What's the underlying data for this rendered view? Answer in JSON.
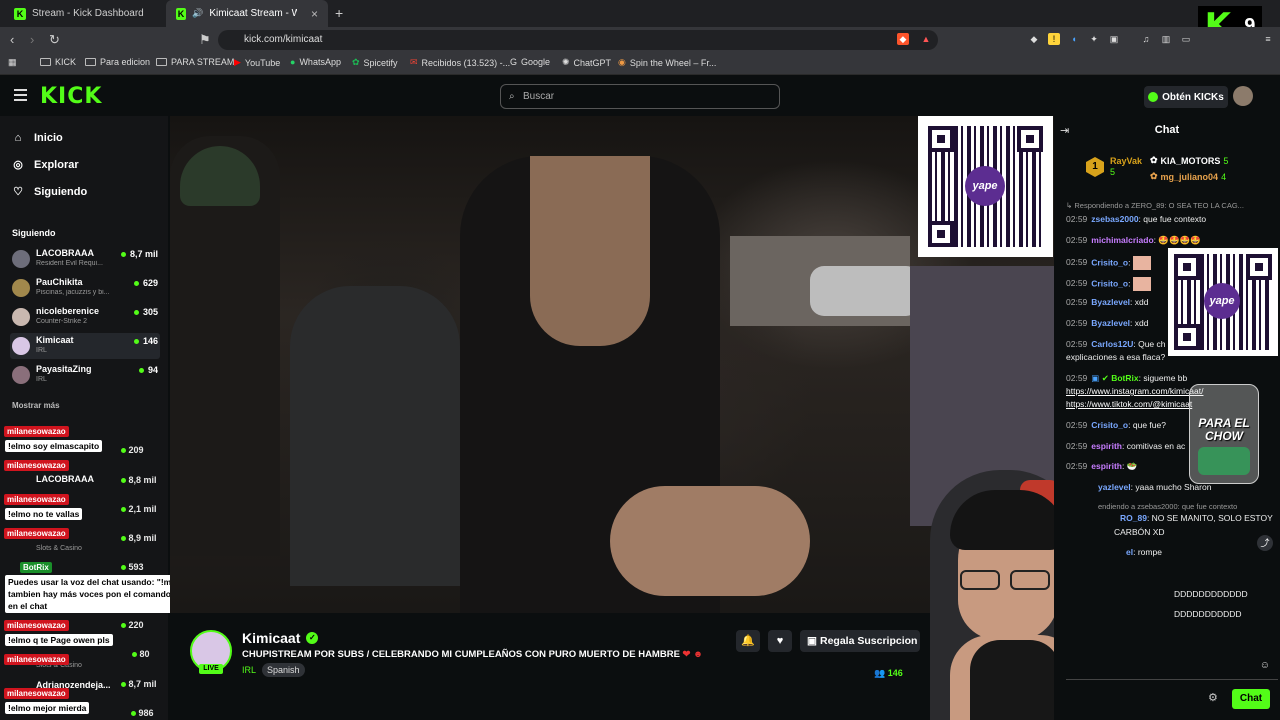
{
  "browser": {
    "tabs": [
      {
        "title": "Stream - Kick Dashboard"
      },
      {
        "title": "Kimicaat Stream - Watch Live"
      }
    ],
    "url": "kick.com/kimicaat",
    "bookmarks": [
      "KICK",
      "Para edicion",
      "PARA STREAM",
      "YouTube",
      "WhatsApp",
      "Spicetify",
      "Recibidos (13.523) -...",
      "Google",
      "ChatGPT",
      "Spin the Wheel – Fr..."
    ]
  },
  "overlay_logo": {
    "number": "9"
  },
  "header": {
    "logo": "KICK",
    "search_placeholder": "Buscar",
    "get_kicks": "Obtén KICKs"
  },
  "sidebar": {
    "nav": [
      {
        "label": "Inicio",
        "icon": "home-icon"
      },
      {
        "label": "Explorar",
        "icon": "compass-icon"
      },
      {
        "label": "Siguiendo",
        "icon": "heart-icon"
      }
    ],
    "section_title": "Siguiendo",
    "channels": [
      {
        "name": "LACOBRAAA",
        "category": "Resident Evil Requi...",
        "viewers": "8,7 mil"
      },
      {
        "name": "PauChikita",
        "category": "Piscinas, jacuzzis y bi...",
        "viewers": "629"
      },
      {
        "name": "nicoleberenice",
        "category": "Counter-Strike 2",
        "viewers": "305"
      },
      {
        "name": "Kimicaat",
        "category": "IRL",
        "viewers": "146"
      },
      {
        "name": "PayasitaZing",
        "category": "IRL",
        "viewers": "94"
      }
    ],
    "show_more": "Mostrar más",
    "recommended_viewers": [
      "209",
      "8,8 mil",
      "2,1 mil",
      "8,9 mil",
      "593",
      "220",
      "80",
      "8,7 mil",
      "986"
    ],
    "recommended_names": [
      "LACOBRAAA",
      "Adrianozendeja..."
    ],
    "recommended_cats": [
      "Slots & Casino",
      "Slots & Casino"
    ]
  },
  "overlay_chat": [
    {
      "user": "milanesowazao",
      "msg": "!elmo soy elmascapito"
    },
    {
      "user": "milanesowazao",
      "msg": ""
    },
    {
      "user": "milanesowazao",
      "msg": "!elmo no te vallas"
    },
    {
      "user": "milanesowazao",
      "msg": ""
    },
    {
      "user": "BotRix",
      "msg": "Puedes usar la voz del chat usando: \"!mura\" .... tambien hay más voces pon el comando \"!voces\" en el chat"
    },
    {
      "user": "milanesowazao",
      "msg": "!elmo q te Page owen pls"
    },
    {
      "user": "milanesowazao",
      "msg": ""
    },
    {
      "user": "milanesowazao",
      "msg": "!elmo mejor mierda"
    }
  ],
  "stream": {
    "channel": "Kimicaat",
    "title": "CHUPISTREAM POR SUBS / CELEBRANDO MI CUMPLEAÑOS CON PURO MUERTO DE HAMBRE",
    "category": "IRL",
    "language": "Spanish",
    "live": "LIVE",
    "sub_button": "Regala Suscripcion",
    "viewers": "146"
  },
  "chat": {
    "title": "Chat",
    "top_gifters": [
      {
        "name": "RayVak",
        "count": "5",
        "rank": "1"
      },
      {
        "name": "KIA_MOTORS",
        "count": "5"
      },
      {
        "name": "mg_juliano04",
        "count": "4"
      }
    ],
    "messages": [
      {
        "reply": "Respondiendo a ZERO_89: O SEA TEO LA CAG..."
      },
      {
        "time": "02:59",
        "user": "zsebas2000",
        "text": "que fue contexto",
        "color": "#7aa8ff"
      },
      {
        "time": "02:59",
        "user": "michimalcriado",
        "text": "🤩🤩🤩🤩",
        "color": "#c77dff"
      },
      {
        "time": "02:59",
        "user": "Crisito_o",
        "text": "",
        "color": "#7aa8ff"
      },
      {
        "time": "02:59",
        "user": "Crisito_o",
        "text": "",
        "color": "#7aa8ff"
      },
      {
        "time": "02:59",
        "user": "Byazlevel",
        "text": "xdd",
        "color": "#7aa8ff"
      },
      {
        "time": "02:59",
        "user": "Byazlevel",
        "text": "xdd",
        "color": "#7aa8ff"
      },
      {
        "time": "02:59",
        "user": "Carlos12U",
        "text": "Que ch",
        "color": "#7aa8ff"
      },
      {
        "time": "",
        "user": "",
        "text": "explicaciones a esa flaca?",
        "color": "#eee"
      },
      {
        "time": "02:59",
        "user": "BotRix",
        "text": "sigueme bb",
        "color": "#53fc18"
      },
      {
        "time": "",
        "user": "",
        "text": "https://www.instagram.com/kimicaat/",
        "color": "#fff"
      },
      {
        "time": "",
        "user": "",
        "text": "https://www.tiktok.com/@kimicaat",
        "color": "#fff"
      },
      {
        "time": "02:59",
        "user": "Crisito_o",
        "text": "que fue?",
        "color": "#7aa8ff"
      },
      {
        "time": "02:59",
        "user": "espirith",
        "text": "comitivas en ac",
        "color": "#c77dff"
      },
      {
        "time": "02:59",
        "user": "espirith",
        "text": "🥗",
        "color": "#c77dff"
      },
      {
        "time": "",
        "user": "yazlevel",
        "text": "yaaa mucho Sharon",
        "color": "#7aa8ff"
      },
      {
        "reply": "endiendo a zsebas2000: que fue contexto"
      },
      {
        "time": "",
        "user": "RO_89",
        "text": "NO SE MANITO, SOLO ESTOY",
        "color": "#7aa8ff"
      },
      {
        "time": "",
        "user": "",
        "text": "CARBÓN XD",
        "color": "#eee"
      },
      {
        "time": "",
        "user": "el",
        "text": "rompe",
        "color": "#7aa8ff"
      },
      {
        "time": "",
        "user": "",
        "text": "DDDDDDDDDDDD",
        "color": "#eee"
      },
      {
        "time": "",
        "user": "",
        "text": "DDDDDDDDDDD",
        "color": "#eee"
      }
    ],
    "send_label": "Chat"
  },
  "overlay_widgets": {
    "para_chow": "PARA EL CHOW",
    "yape": "yape"
  },
  "colors": {
    "brand": "#53fc18",
    "background": "#0b0e0f",
    "sidebar": "#141517",
    "alert_red": "#d0141e"
  }
}
